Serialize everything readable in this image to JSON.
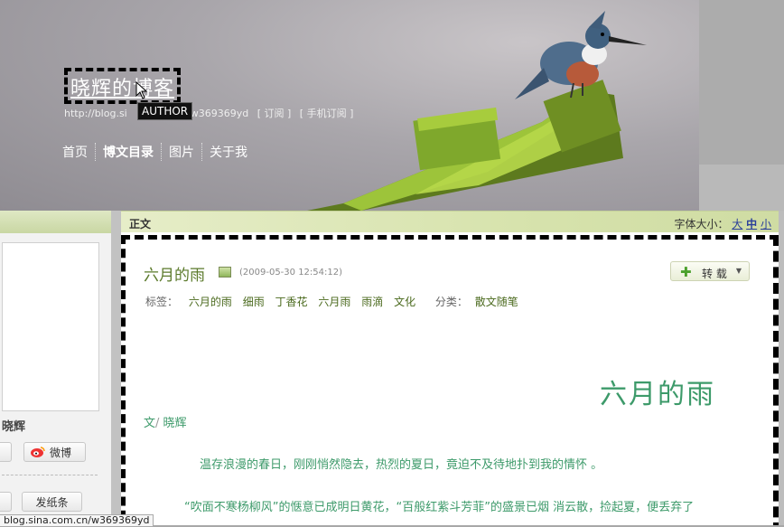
{
  "header": {
    "blog_title": "晓辉的博客",
    "url_prefix": "http://blog.si",
    "url_suffix": "w369369yd",
    "subscribe": "[ 订阅 ]",
    "mobile_subscribe": "[ 手机订阅 ]",
    "tooltip": "AUTHOR"
  },
  "nav": [
    "首页",
    "博文目录",
    "图片",
    "关于我"
  ],
  "sidebar": {
    "name": "晓辉",
    "weibo_button": "微博",
    "post_button": "发纸条"
  },
  "main": {
    "section_label": "正文",
    "font_size_label": "字体大小：",
    "font_large": "大",
    "font_medium": "中",
    "font_small": "小"
  },
  "article": {
    "title": "六月的雨",
    "date": "(2009-05-30 12:54:12)",
    "repost": "转 载",
    "tags_label": "标签：",
    "tags": [
      "六月的雨",
      "细雨",
      "丁香花",
      "六月雨",
      "雨滴",
      "文化"
    ],
    "category_label": "分类：",
    "category": "散文随笔",
    "big_title": "六月的雨",
    "byline_prefix": "文",
    "byline_sep": "/",
    "byline_author": "晓辉",
    "para1": "温存浪漫的春日，刚刚悄然隐去，热烈的夏日，竟迫不及待地扑到我的情怀 。",
    "para2": "“吹面不寒杨柳风”的惬意已成明日黄花，“百般红紫斗芳菲”的盛景已烟 消云散，捡起夏，便丢弃了"
  },
  "status_bar": "blog.sina.com.cn/w369369yd",
  "colors": {
    "title_green": "#5b7a2b",
    "text_green": "#3d9a6a",
    "header_band": "#d7e3ad"
  }
}
